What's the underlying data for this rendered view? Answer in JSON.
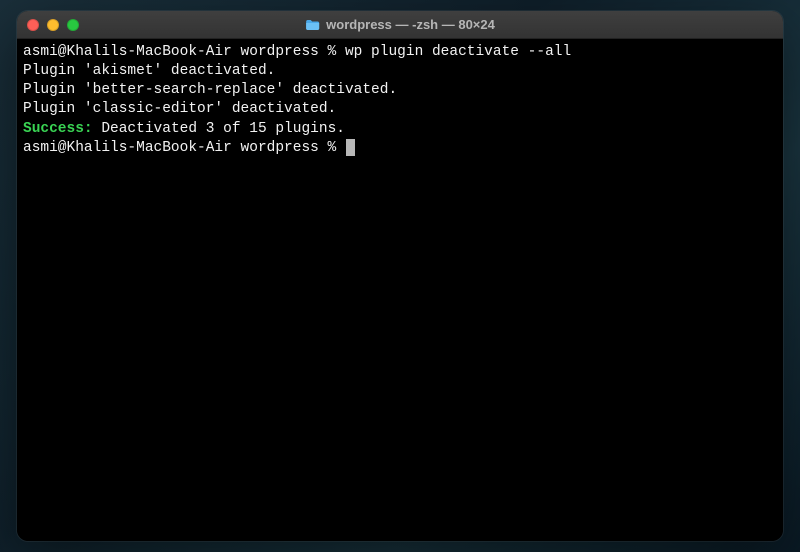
{
  "titlebar": {
    "title": "wordpress — -zsh — 80×24"
  },
  "terminal": {
    "line1_prompt": "asmi@Khalils-MacBook-Air wordpress % ",
    "line1_command": "wp plugin deactivate --all",
    "line2": "Plugin 'akismet' deactivated.",
    "line3": "Plugin 'better-search-replace' deactivated.",
    "line4": "Plugin 'classic-editor' deactivated.",
    "line5_success": "Success:",
    "line5_rest": " Deactivated 3 of 15 plugins.",
    "line6_prompt": "asmi@Khalils-MacBook-Air wordpress % "
  }
}
